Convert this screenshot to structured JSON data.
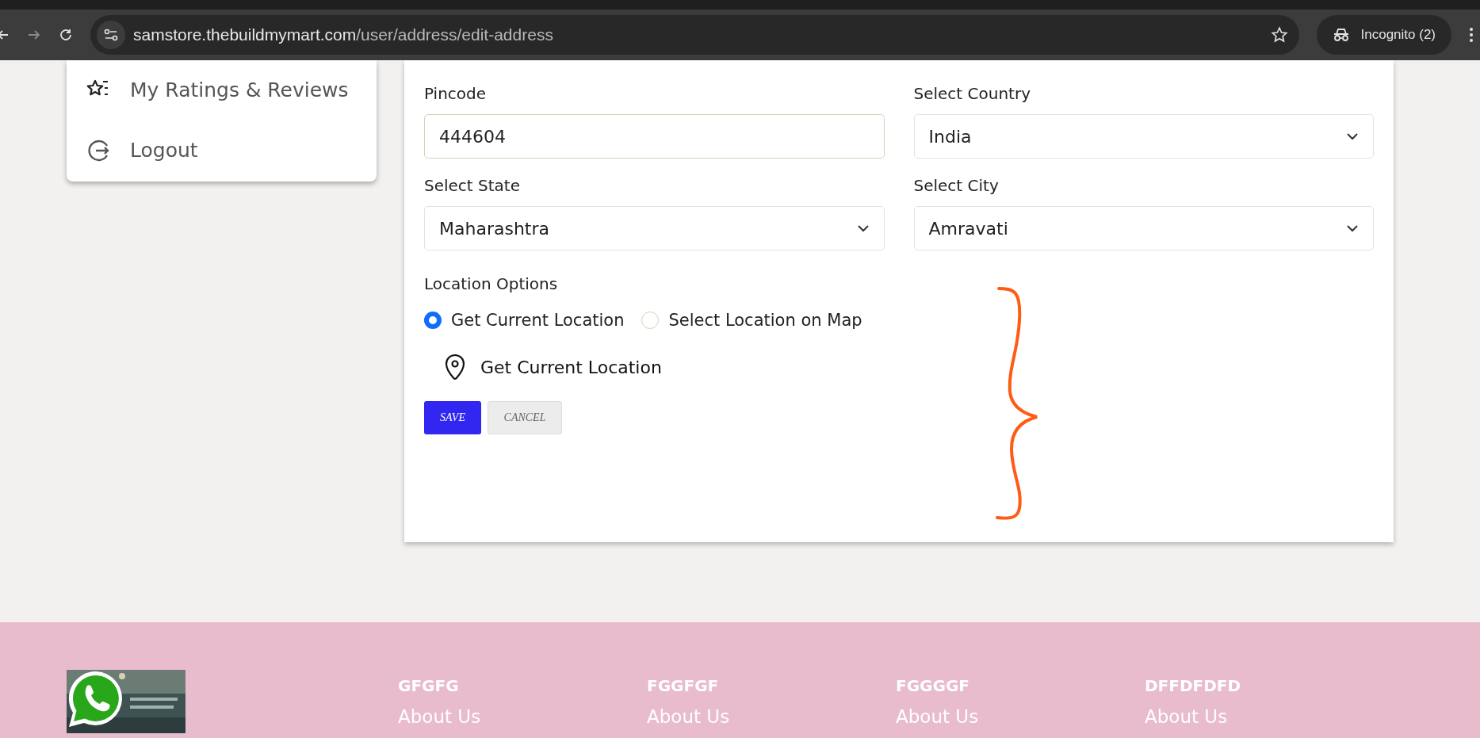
{
  "browser": {
    "url_host": "samstore.thebuildmymart.com",
    "url_path": "/user/address/edit-address",
    "profile": "Incognito (2)"
  },
  "sidebar": {
    "items": [
      {
        "kind": "ratings",
        "label": "My Ratings & Reviews"
      },
      {
        "kind": "logout",
        "label": "Logout"
      }
    ]
  },
  "form": {
    "fields": [
      {
        "kind": "input",
        "label": "Pincode",
        "value": "444604",
        "focused": true
      },
      {
        "kind": "select",
        "label": "Select Country",
        "value": "India",
        "focused": false
      },
      {
        "kind": "select",
        "label": "Select State",
        "value": "Maharashtra",
        "focused": false
      },
      {
        "kind": "select",
        "label": "Select City",
        "value": "Amravati",
        "focused": false
      }
    ],
    "location": {
      "label": "Location Options",
      "options": [
        {
          "label": "Get Current Location",
          "selected": true
        },
        {
          "label": "Select Location on Map",
          "selected": false
        }
      ],
      "action": "Get Current Location"
    },
    "buttons": [
      {
        "kind": "primary",
        "label": "SAVE"
      },
      {
        "kind": "secondary",
        "label": "CANCEL"
      }
    ]
  },
  "annotation": {
    "kind": "brace"
  },
  "footer": {
    "columns": [
      {
        "heading": "GFGFG",
        "links": [
          "About Us"
        ]
      },
      {
        "heading": "FGGFGF",
        "links": [
          "About Us"
        ]
      },
      {
        "heading": "FGGGGF",
        "links": [
          "About Us"
        ]
      },
      {
        "heading": "DFFDFDFD",
        "links": [
          "About Us"
        ]
      }
    ]
  }
}
